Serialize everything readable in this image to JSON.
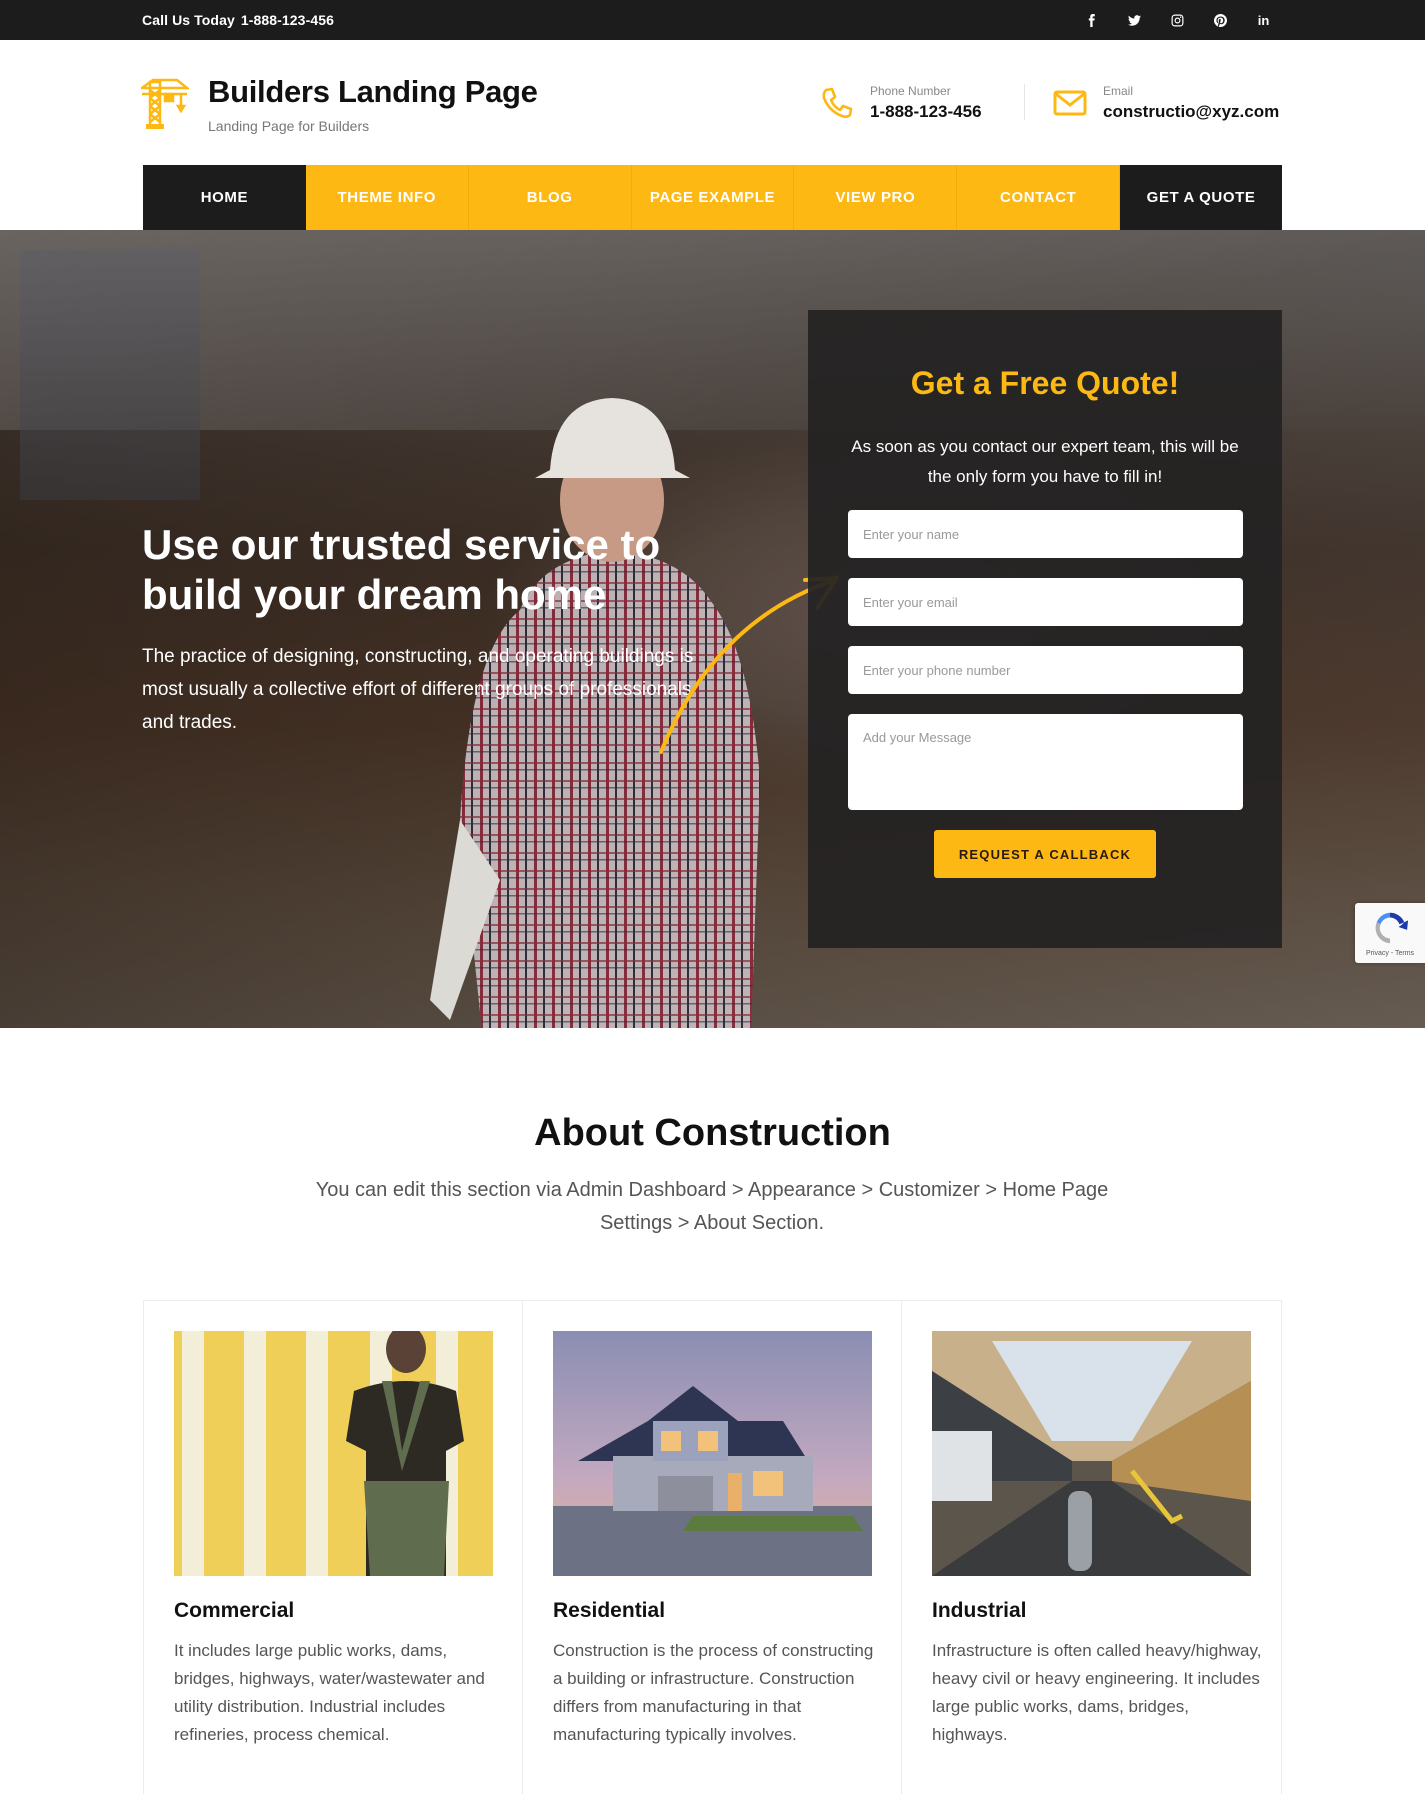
{
  "topbar": {
    "call_label": "Call Us Today",
    "call_number": "1-888-123-456",
    "social": [
      {
        "name": "facebook",
        "icon": "facebook-icon"
      },
      {
        "name": "twitter",
        "icon": "twitter-icon"
      },
      {
        "name": "instagram",
        "icon": "instagram-icon"
      },
      {
        "name": "pinterest",
        "icon": "pinterest-icon"
      },
      {
        "name": "linkedin",
        "icon": "linkedin-icon",
        "glyph": "in"
      }
    ]
  },
  "header": {
    "site_title": "Builders Landing Page",
    "tagline": "Landing Page for Builders",
    "phone_label": "Phone Number",
    "phone_value": "1-888-123-456",
    "email_label": "Email",
    "email_value": "constructio@xyz.com"
  },
  "nav": {
    "items": [
      "HOME",
      "THEME INFO",
      "BLOG",
      "PAGE EXAMPLE",
      "VIEW PRO",
      "CONTACT"
    ],
    "active": "HOME",
    "quote_button": "GET A QUOTE"
  },
  "hero": {
    "headline": "Use our trusted service to build your dream home",
    "description": "The practice of designing, constructing, and operating buildings is most usually a collective effort of different groups of professionals and trades."
  },
  "quote_form": {
    "title": "Get a Free Quote!",
    "subtitle": "As soon as you contact our expert team, this will be the only form you have to fill in!",
    "name_placeholder": "Enter your name",
    "email_placeholder": "Enter your email",
    "phone_placeholder": "Enter your phone number",
    "message_placeholder": "Add your Message",
    "submit_label": "REQUEST A CALLBACK"
  },
  "recaptcha": {
    "label": "Privacy - Terms"
  },
  "about": {
    "title": "About Construction",
    "description": "You can edit this section via Admin Dashboard > Appearance > Customizer > Home Page Settings > About Section.",
    "cards": [
      {
        "title": "Commercial",
        "text": "It includes large public works, dams, bridges, highways, water/wastewater and utility distribution. Industrial includes refineries, process chemical.",
        "image": "painter-at-striped-wall"
      },
      {
        "title": "Residential",
        "text": "Construction is the process of constructing a building or infrastructure. Construction differs from manufacturing in that manufacturing typically involves.",
        "image": "house-at-dusk"
      },
      {
        "title": "Industrial",
        "text": "Infrastructure is often called heavy/highway, heavy civil or heavy engineering. It includes large public works, dams, bridges, highways.",
        "image": "factory-hall"
      }
    ]
  },
  "colors": {
    "accent": "#fdb813",
    "dark": "#1c1c1c",
    "text": "#111111",
    "muted": "#555555"
  }
}
